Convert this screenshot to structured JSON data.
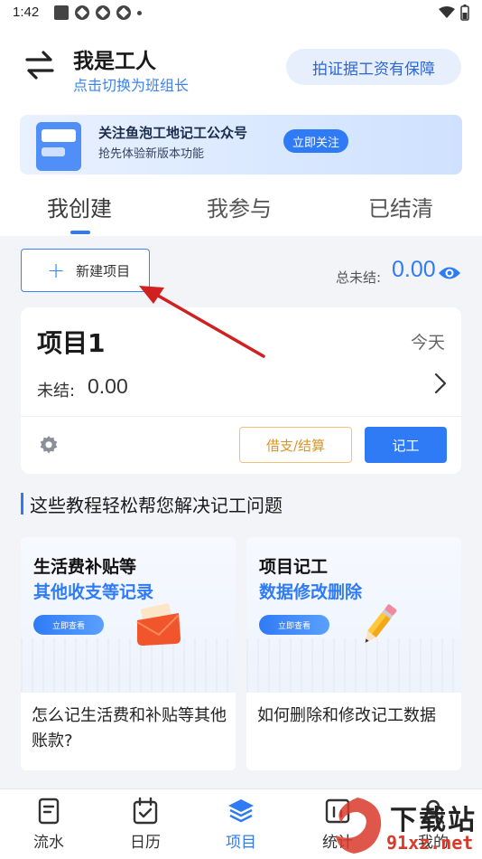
{
  "status_bar": {
    "time": "1:42"
  },
  "header": {
    "user_name": "我是工人",
    "switch_hint": "点击切换为班组长",
    "wage_button": "拍证据工资有保障"
  },
  "banner": {
    "title": "关注鱼泡工地记工公众号",
    "subtitle": "抢先体验新版本功能",
    "button": "立即关注"
  },
  "tabs": [
    {
      "label": "我创建",
      "active": true
    },
    {
      "label": "我参与",
      "active": false
    },
    {
      "label": "已结清",
      "active": false
    }
  ],
  "toolbar": {
    "new_project": "新建项目",
    "total_label": "总未结:",
    "total_value": "0.00"
  },
  "project": {
    "name": "项目1",
    "date": "今天",
    "unsettled_label": "未结:",
    "unsettled_value": "0.00",
    "loan_button": "借支/结算",
    "record_button": "记工"
  },
  "tutorials": {
    "title": "这些教程轻松帮您解决记工问题",
    "items": [
      {
        "headline1": "生活费补贴等",
        "headline2": "其他收支等记录",
        "view_button": "立即查看",
        "caption": "怎么记生活费和补贴等其他账款?"
      },
      {
        "headline1": "项目记工",
        "headline2": "数据修改删除",
        "view_button": "立即查看",
        "caption": "如何删除和修改记工数据"
      }
    ]
  },
  "bottom_nav": [
    {
      "label": "流水",
      "icon": "document-icon",
      "active": false
    },
    {
      "label": "日历",
      "icon": "calendar-icon",
      "active": false
    },
    {
      "label": "项目",
      "icon": "layers-icon",
      "active": true
    },
    {
      "label": "统计",
      "icon": "chart-icon",
      "active": false
    },
    {
      "label": "我的",
      "icon": "person-icon",
      "active": false
    }
  ],
  "watermark": {
    "text": "下载站",
    "url": "91xz.net"
  },
  "colors": {
    "accent": "#2f7bf5",
    "orange": "#d9942a",
    "arrow": "#d0201f"
  }
}
